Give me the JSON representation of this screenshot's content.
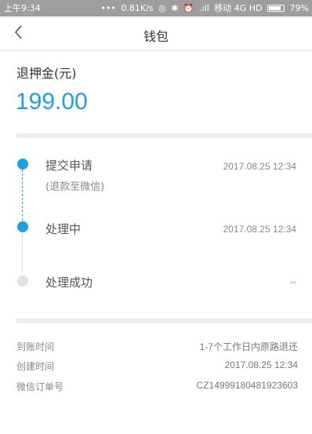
{
  "status_bar": {
    "time": "上午9:34",
    "net_speed": "0.81K/s",
    "carrier": "移动 4G HD",
    "battery": "79%"
  },
  "nav": {
    "title": "钱包",
    "back_icon": "chevron-left-icon"
  },
  "refund": {
    "label": "退押金(元)",
    "amount": "199.00",
    "accent_color": "#1ea0e8"
  },
  "steps": [
    {
      "label": "提交申请",
      "sub": "(退款至微信)",
      "time": "2017.08.25 12:34",
      "state": "done"
    },
    {
      "label": "处理中",
      "sub": "",
      "time": "2017.08.25 12:34",
      "state": "done"
    },
    {
      "label": "处理成功",
      "sub": "",
      "time": "--",
      "state": "pending"
    }
  ],
  "info": [
    {
      "label": "到账时间",
      "value": "1-7个工作日内原路退还"
    },
    {
      "label": "创建时间",
      "value": "2017.08.25 12:34"
    },
    {
      "label": "微信订单号",
      "value": "CZ14999180481923603"
    }
  ]
}
